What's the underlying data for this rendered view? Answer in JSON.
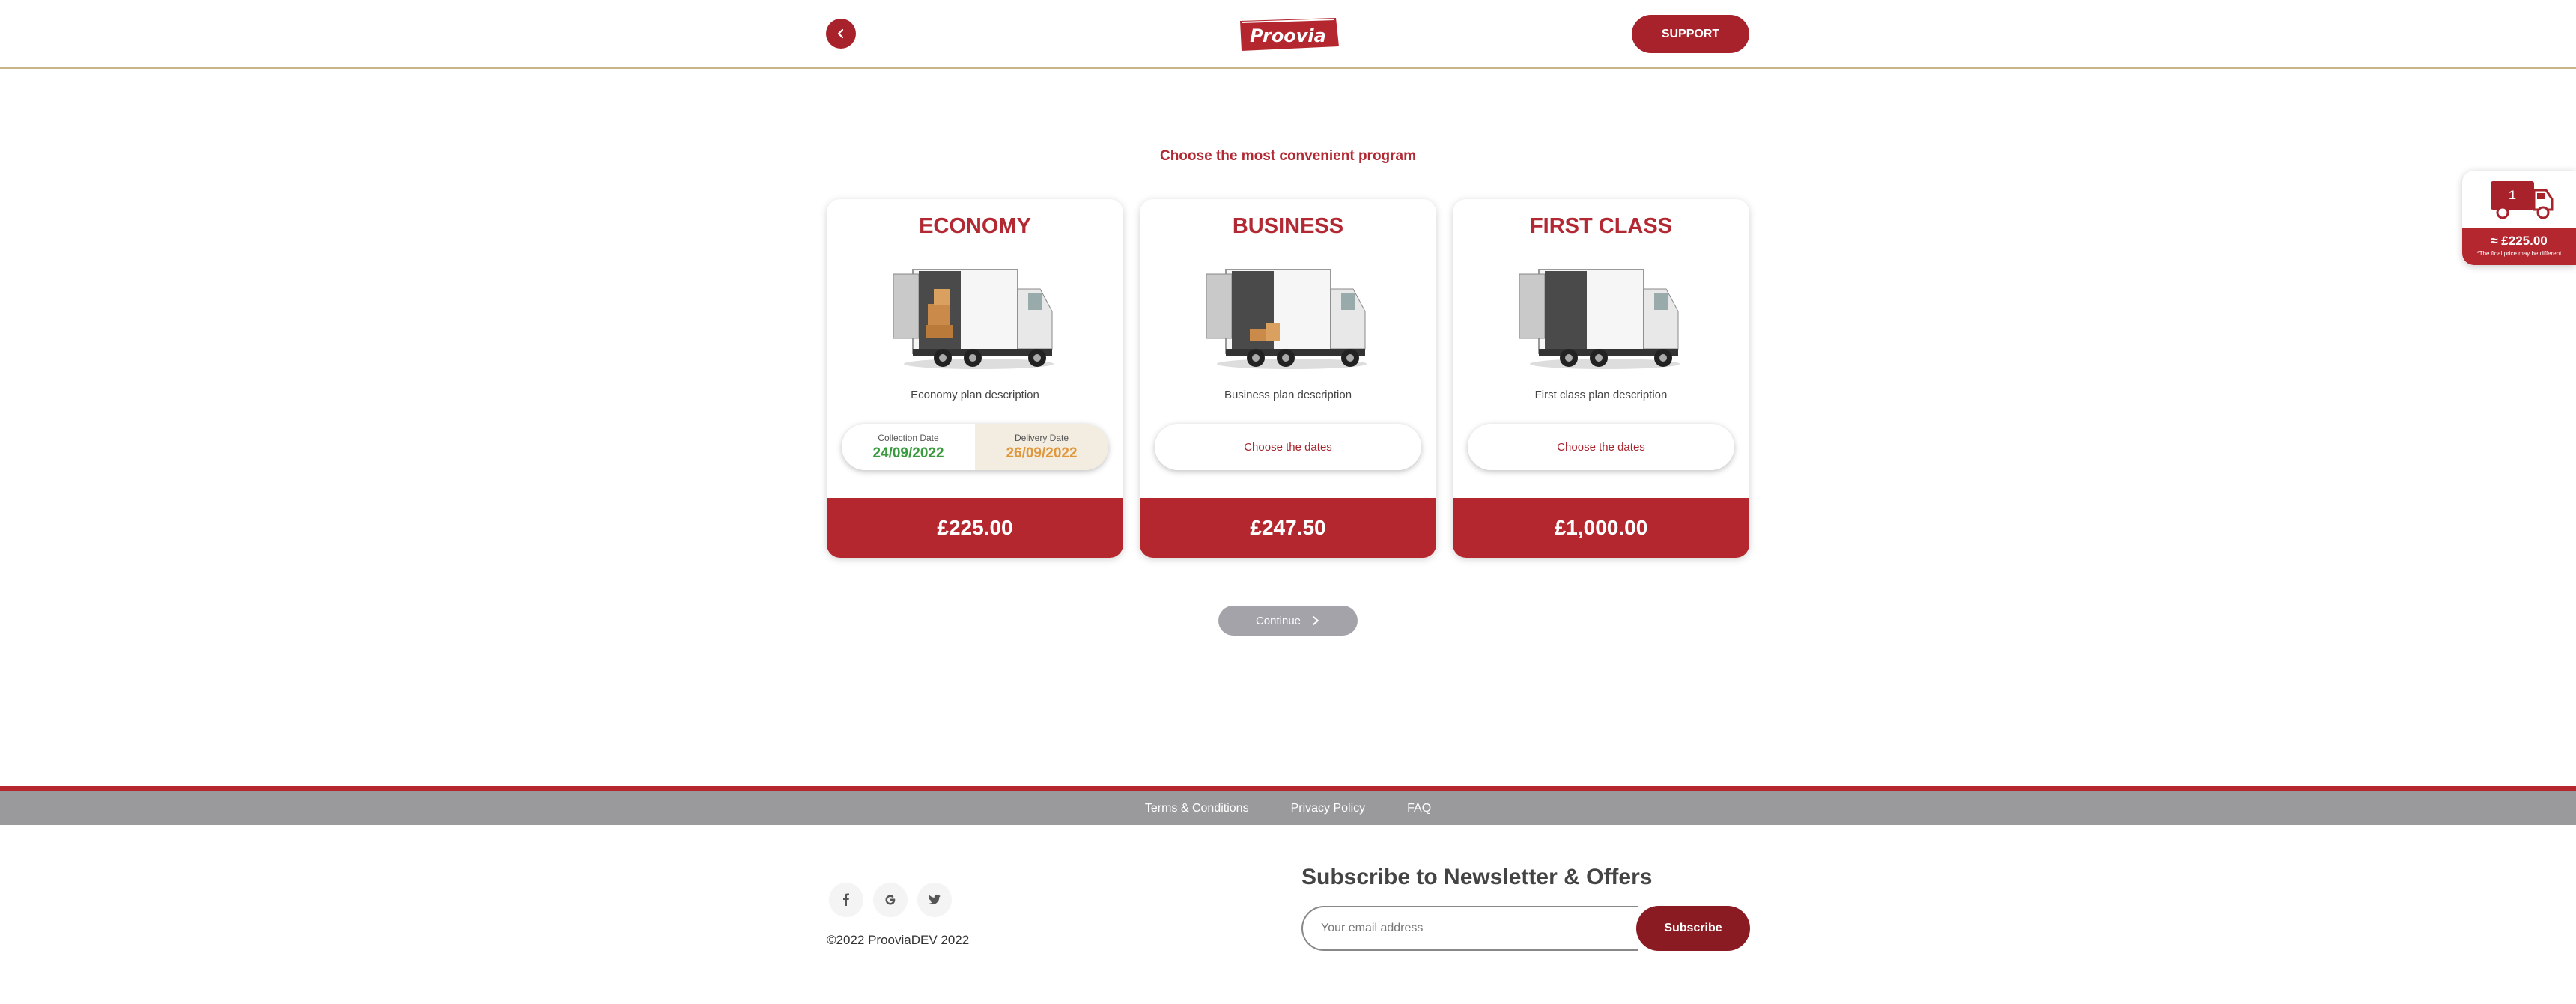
{
  "header": {
    "back_icon": "chevron-left-icon",
    "logo_text": "Proovia",
    "support_label": "SUPPORT"
  },
  "page_title": "Choose the most convenient program",
  "plans": [
    {
      "title": "ECONOMY",
      "description": "Economy plan description",
      "collection_label": "Collection Date",
      "collection_date": "24/09/2022",
      "delivery_label": "Delivery Date",
      "delivery_date": "26/09/2022",
      "price": "£225.00"
    },
    {
      "title": "BUSINESS",
      "description": "Business plan description",
      "dates_button": "Choose the dates",
      "price": "£247.50"
    },
    {
      "title": "FIRST CLASS",
      "description": "First class plan description",
      "dates_button": "Choose the dates",
      "price": "£1,000.00"
    }
  ],
  "continue_label": "Continue",
  "cart": {
    "count": "1",
    "price": "≈ £225.00",
    "note": "*The final price may be different"
  },
  "footer": {
    "links": [
      "Terms & Conditions",
      "Privacy Policy",
      "FAQ"
    ],
    "social_icons": [
      "facebook-icon",
      "google-icon",
      "twitter-icon"
    ],
    "copyright": "©2022 ProoviaDEV 2022",
    "newsletter_title": "Subscribe to Newsletter & Offers",
    "email_placeholder": "Your email address",
    "subscribe_label": "Subscribe"
  },
  "colors": {
    "brand_red": "#b4272f",
    "collection_green": "#3a9a3e",
    "delivery_orange": "#e0973a",
    "disabled_grey": "#a3a3a9"
  }
}
